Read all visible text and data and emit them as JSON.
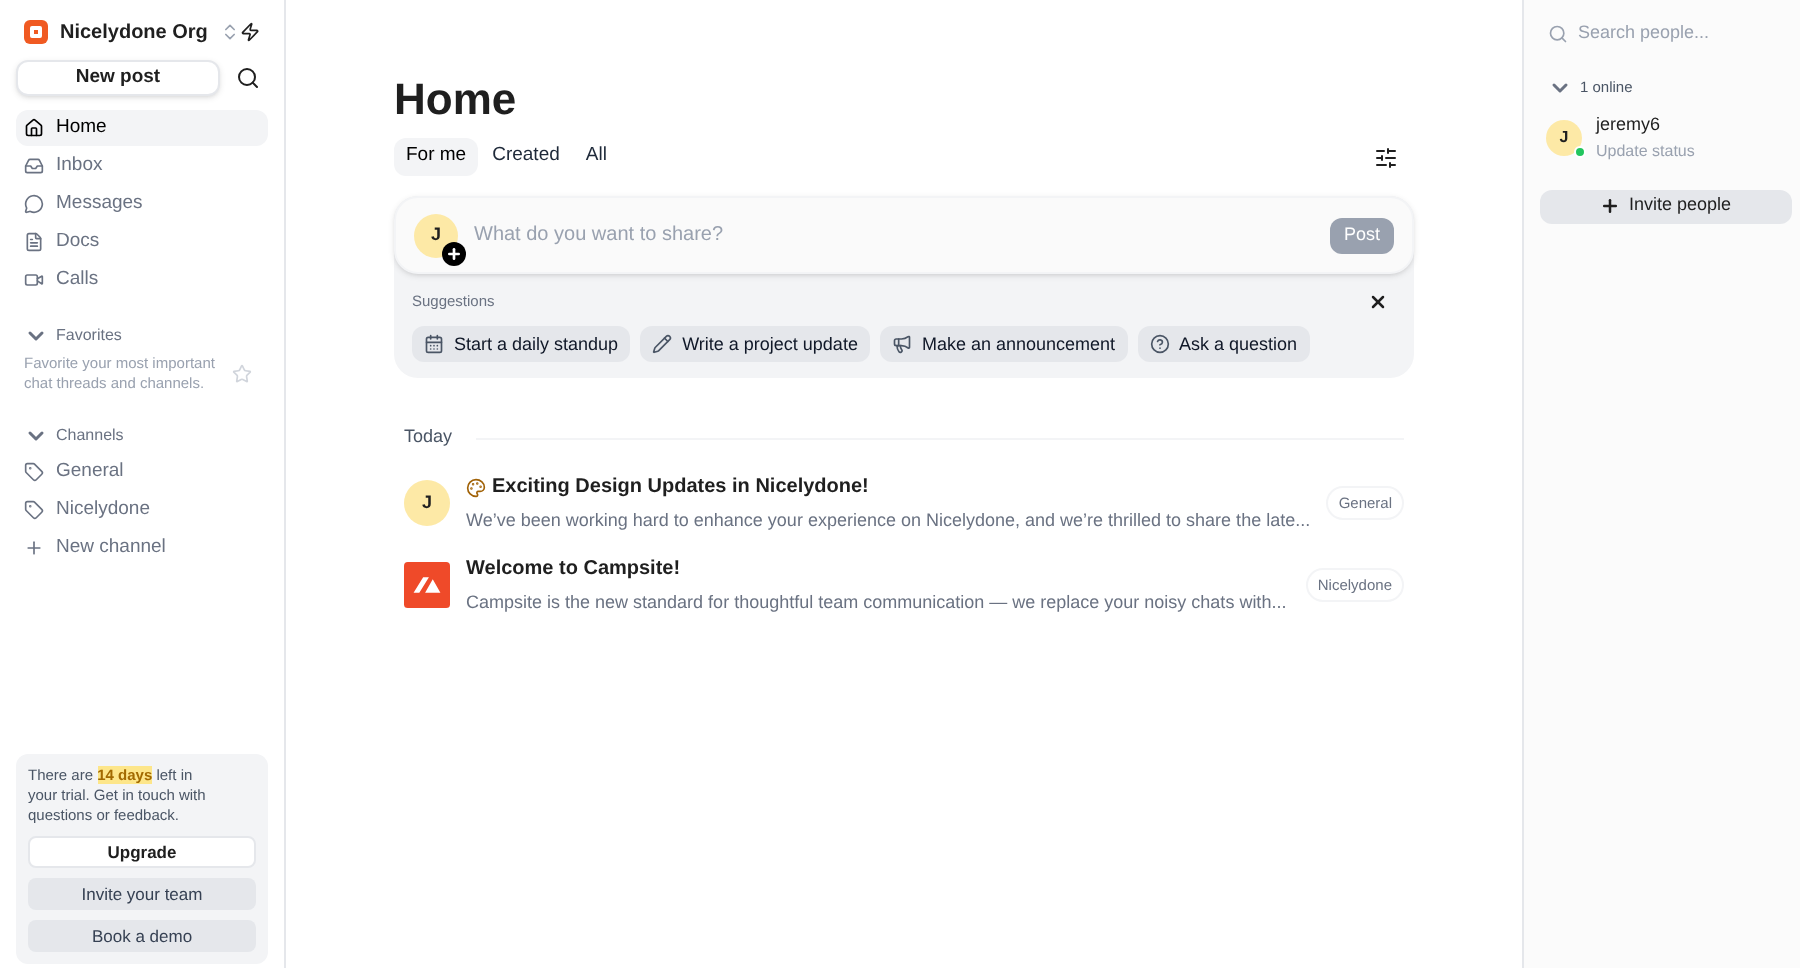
{
  "org": {
    "name": "Nicelydone Org"
  },
  "new_post": "New post",
  "nav": [
    {
      "label": "Home",
      "selected": true
    },
    {
      "label": "Inbox",
      "selected": false
    },
    {
      "label": "Messages",
      "selected": false
    },
    {
      "label": "Docs",
      "selected": false
    },
    {
      "label": "Calls",
      "selected": false
    }
  ],
  "favorites": {
    "title": "Favorites",
    "expanded": true,
    "hint": "Favorite your most important chat threads and channels."
  },
  "channels": {
    "title": "Channels",
    "expanded": true,
    "items": [
      {
        "label": "General"
      },
      {
        "label": "Nicelydone"
      }
    ],
    "add": "New channel"
  },
  "trial": {
    "text": "There are **14 days** left in your trial. Get in touch with questions or feedback.",
    "buttons": [
      {
        "label": "Upgrade",
        "kind": "primary"
      },
      {
        "label": "Invite your team",
        "kind": "secondary"
      },
      {
        "label": "Book a demo",
        "kind": "secondary"
      }
    ]
  },
  "page_title": "Home",
  "tabs": [
    {
      "label": "For me",
      "selected": true
    },
    {
      "label": "Created",
      "selected": false
    },
    {
      "label": "All",
      "selected": false
    }
  ],
  "composer": {
    "avatar": "J",
    "placeholder": "What do you want to share?",
    "post": "Post",
    "disabled": true
  },
  "suggestions": {
    "title": "Suggestions",
    "items": [
      {
        "label": "Start a daily standup"
      },
      {
        "label": "Write a project update"
      },
      {
        "label": "Make an announcement"
      },
      {
        "label": "Ask a question"
      }
    ]
  },
  "feed": {
    "section": "Today",
    "posts": [
      {
        "kind": "user",
        "avatar": "J",
        "title": "Exciting Design Updates in Nicelydone!",
        "preview": "We’ve been working hard to enhance your experience on Nicelydone, and we’re thrilled to share the late...",
        "channel": "General"
      },
      {
        "kind": "app",
        "title": "Welcome to Campsite!",
        "preview": "Campsite is the new standard for thoughtful team communication — we replace your noisy chats with...",
        "channel": "Nicelydone"
      }
    ]
  },
  "people": {
    "search_placeholder": "Search people...",
    "online_label": "1 online",
    "expanded": true,
    "users": [
      {
        "avatar": "J",
        "name": "jeremy6",
        "status": "Update status",
        "online": true
      }
    ],
    "invite": "Invite people"
  }
}
